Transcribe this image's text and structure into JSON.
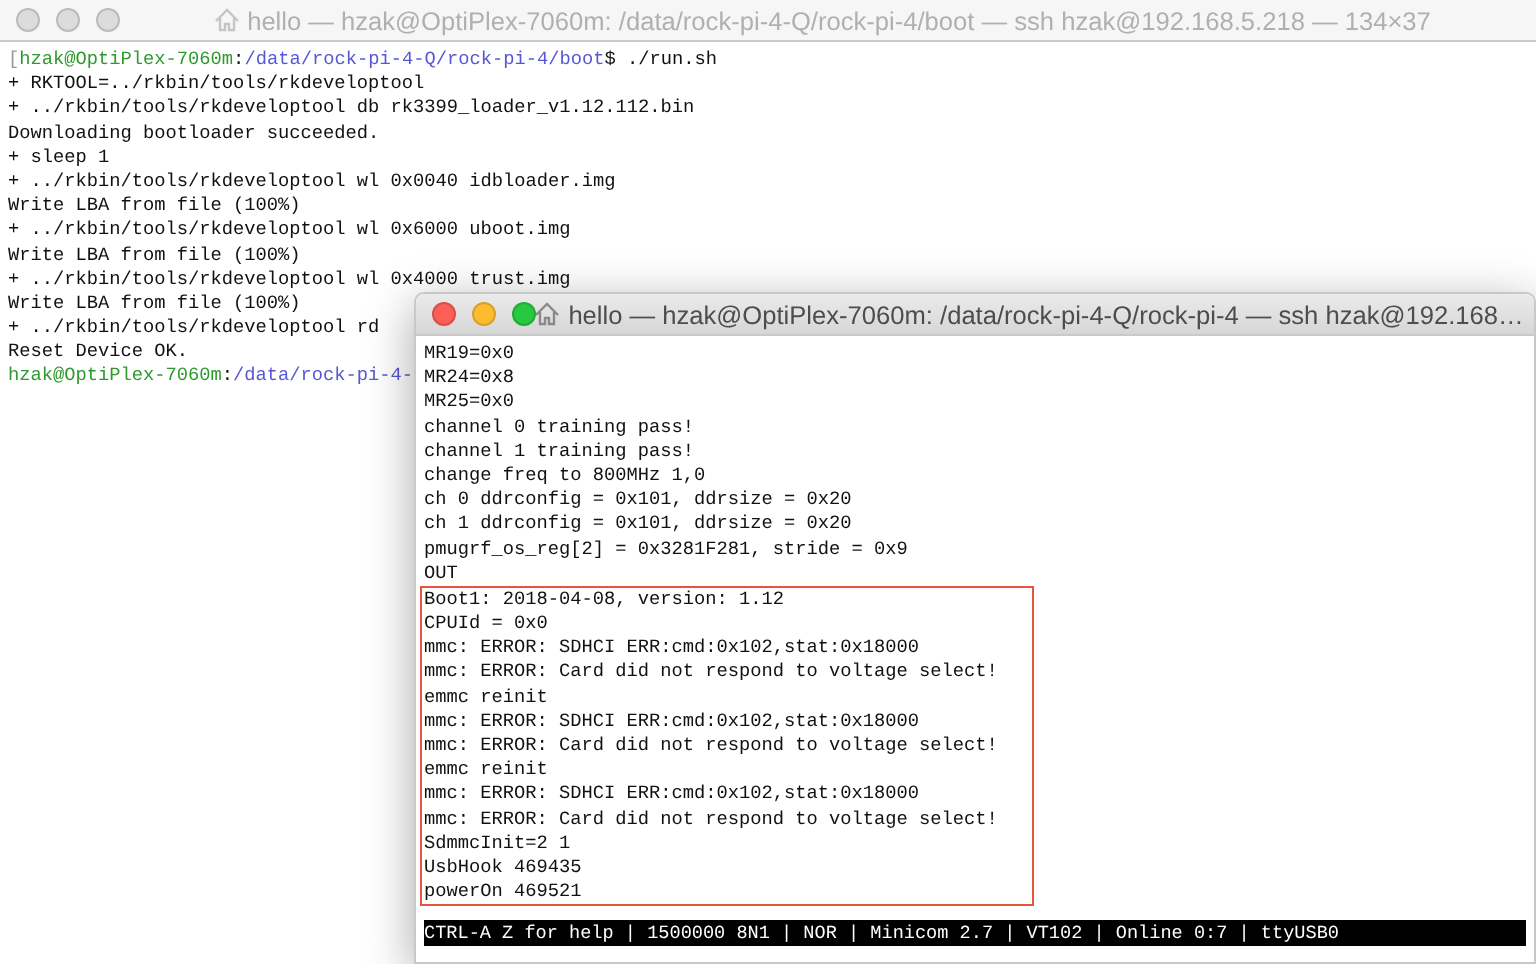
{
  "back_window": {
    "title": "hello — hzak@OptiPlex-7060m: /data/rock-pi-4-Q/rock-pi-4/boot — ssh hzak@192.168.5.218 — 134×37",
    "active": false,
    "lines": [
      {
        "kind": "prompt",
        "mark": "[",
        "user": "hzak@OptiPlex-7060m",
        "sep": ":",
        "path": "/data/rock-pi-4-Q/rock-pi-4/boot",
        "command": "$ ./run.sh"
      },
      {
        "kind": "output",
        "text": "+ RKTOOL=../rkbin/tools/rkdeveloptool"
      },
      {
        "kind": "output",
        "text": "+ ../rkbin/tools/rkdeveloptool db rk3399_loader_v1.12.112.bin"
      },
      {
        "kind": "output",
        "text": "Downloading bootloader succeeded."
      },
      {
        "kind": "output",
        "text": "+ sleep 1"
      },
      {
        "kind": "output",
        "text": "+ ../rkbin/tools/rkdeveloptool wl 0x0040 idbloader.img"
      },
      {
        "kind": "output",
        "text": "Write LBA from file (100%)"
      },
      {
        "kind": "output",
        "text": "+ ../rkbin/tools/rkdeveloptool wl 0x6000 uboot.img"
      },
      {
        "kind": "output",
        "text": "Write LBA from file (100%)"
      },
      {
        "kind": "output",
        "text": "+ ../rkbin/tools/rkdeveloptool wl 0x4000 trust.img"
      },
      {
        "kind": "output",
        "text": "Write LBA from file (100%)"
      },
      {
        "kind": "output",
        "text": "+ ../rkbin/tools/rkdeveloptool rd"
      },
      {
        "kind": "output",
        "text": "Reset Device OK."
      },
      {
        "kind": "prompt",
        "user": "hzak@OptiPlex-7060m",
        "sep": ":",
        "path": "/data/rock-pi-4-"
      }
    ]
  },
  "front_window": {
    "title": "hello — hzak@OptiPlex-7060m: /data/rock-pi-4-Q/rock-pi-4 — ssh hzak@192.168…",
    "active": true,
    "lines": [
      "MR19=0x0",
      "MR24=0x8",
      "MR25=0x0",
      "channel 0 training pass!",
      "channel 1 training pass!",
      "change freq to 800MHz 1,0",
      "ch 0 ddrconfig = 0x101, ddrsize = 0x20",
      "ch 1 ddrconfig = 0x101, ddrsize = 0x20",
      "pmugrf_os_reg[2] = 0x3281F281, stride = 0x9",
      "OUT"
    ],
    "highlighted_lines": [
      "Boot1: 2018-04-08, version: 1.12",
      "CPUId = 0x0",
      "mmc: ERROR: SDHCI ERR:cmd:0x102,stat:0x18000",
      "mmc: ERROR: Card did not respond to voltage select!",
      "emmc reinit",
      "mmc: ERROR: SDHCI ERR:cmd:0x102,stat:0x18000",
      "mmc: ERROR: Card did not respond to voltage select!",
      "emmc reinit",
      "mmc: ERROR: SDHCI ERR:cmd:0x102,stat:0x18000",
      "mmc: ERROR: Card did not respond to voltage select!",
      "SdmmcInit=2 1",
      "UsbHook 469435",
      "powerOn 469521"
    ],
    "status_bar": "CTRL-A Z for help | 1500000 8N1 | NOR | Minicom 2.7 | VT102 | Online 0:7 | ttyUSB0"
  }
}
